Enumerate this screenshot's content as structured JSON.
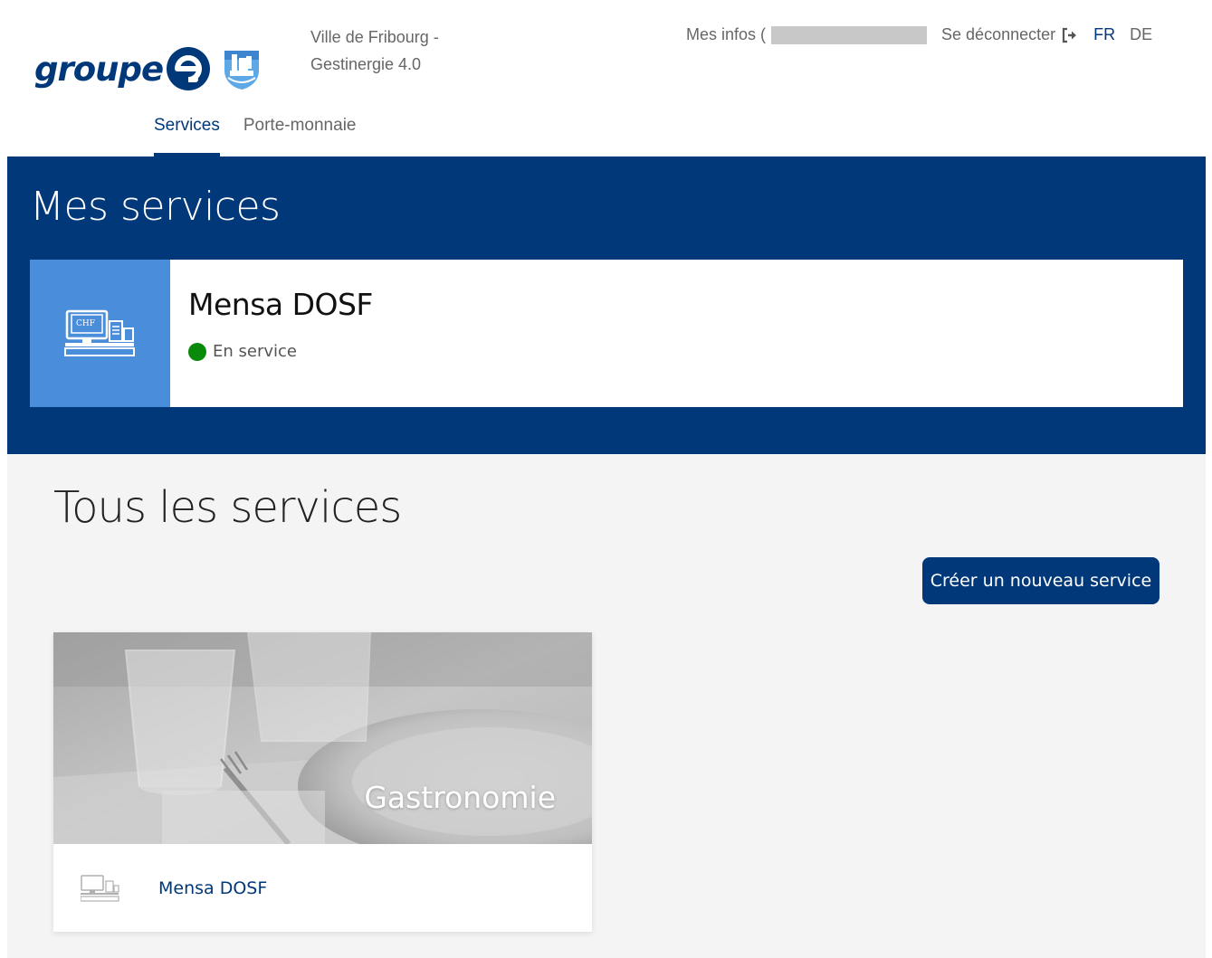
{
  "header": {
    "logo_text": "groupe",
    "org_line1": "Ville de Fribourg -",
    "org_line2": "Gestinergie 4.0",
    "my_info_label": "Mes infos (",
    "logout_label": "Se déconnecter",
    "languages": [
      "FR",
      "DE"
    ],
    "active_language": "FR",
    "tabs": [
      {
        "label": "Services",
        "active": true
      },
      {
        "label": "Porte-monnaie",
        "active": false
      }
    ]
  },
  "my_services": {
    "title": "Mes services",
    "items": [
      {
        "name": "Mensa DOSF",
        "status": "En service",
        "status_color": "#0a8a0a",
        "icon": "cash-register-icon",
        "icon_text": "CHF"
      }
    ]
  },
  "all_services": {
    "title": "Tous les services",
    "create_button_label": "Créer un nouveau service",
    "categories": [
      {
        "label": "Gastronomie",
        "services": [
          {
            "name": "Mensa DOSF",
            "icon": "cash-register-icon"
          }
        ]
      }
    ]
  },
  "colors": {
    "brand": "#00387a",
    "accent_light": "#4a8edb",
    "page_bg": "#f4f4f4",
    "status_ok": "#0a8a0a"
  }
}
